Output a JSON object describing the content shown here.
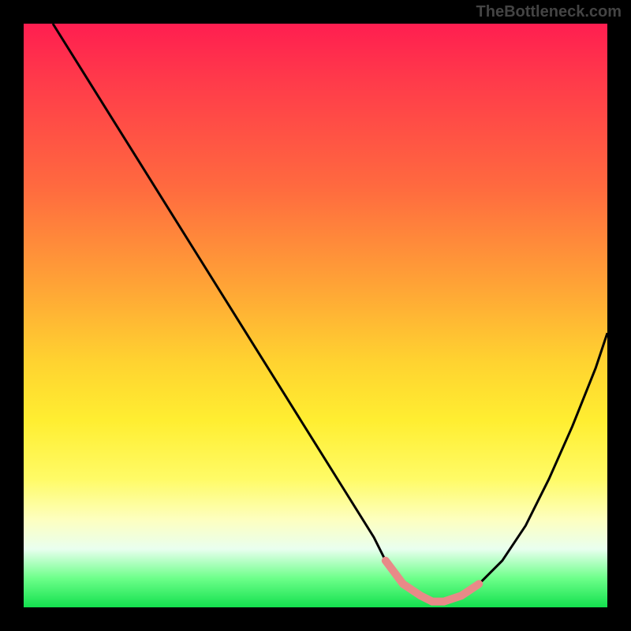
{
  "watermark": "TheBottleneck.com",
  "chart_data": {
    "type": "line",
    "title": "",
    "xlabel": "",
    "ylabel": "",
    "xlim": [
      0,
      100
    ],
    "ylim": [
      0,
      100
    ],
    "series": [
      {
        "name": "curve-main",
        "x": [
          5,
          10,
          15,
          20,
          25,
          30,
          35,
          40,
          45,
          50,
          55,
          60,
          62,
          65,
          68,
          70,
          72,
          75,
          78,
          82,
          86,
          90,
          94,
          98,
          100
        ],
        "values": [
          100,
          92,
          84,
          76,
          68,
          60,
          52,
          44,
          36,
          28,
          20,
          12,
          8,
          4,
          2,
          1,
          1,
          2,
          4,
          8,
          14,
          22,
          31,
          41,
          47
        ]
      },
      {
        "name": "flat-zone-highlight",
        "x": [
          62,
          65,
          68,
          70,
          72,
          75,
          78
        ],
        "values": [
          8,
          4,
          2,
          1,
          1,
          2,
          4
        ]
      }
    ],
    "annotations": []
  },
  "colors": {
    "gradient_top": "#ff1e50",
    "gradient_bottom": "#13e04e",
    "curve": "#000000",
    "highlight": "#e88a88"
  }
}
